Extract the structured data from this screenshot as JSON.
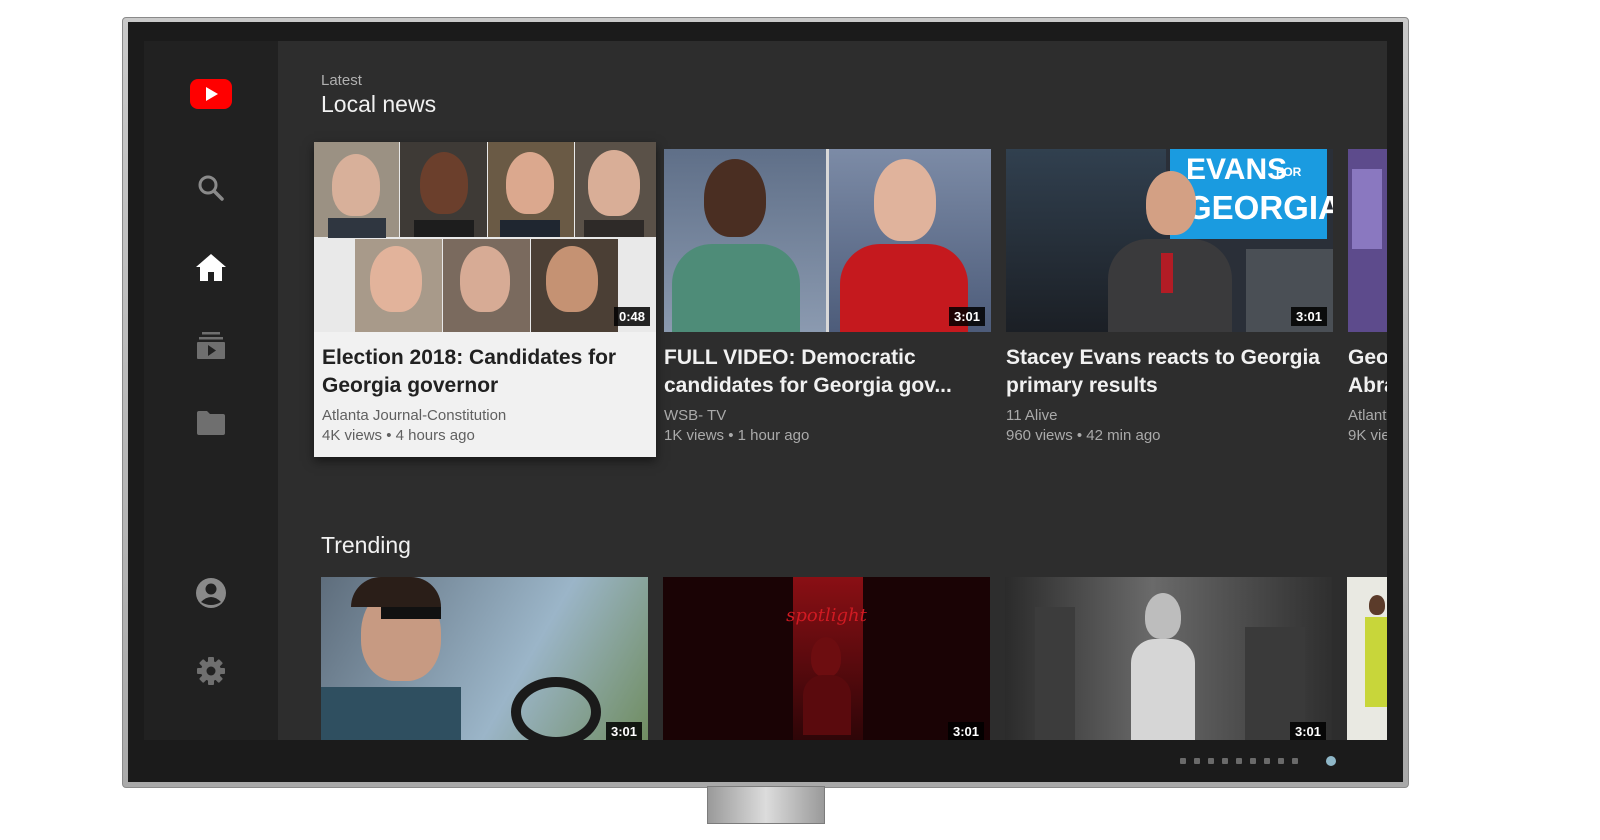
{
  "sidebar": {
    "logo": "youtube-logo",
    "items": [
      {
        "name": "search",
        "icon": "search-icon"
      },
      {
        "name": "home",
        "icon": "home-icon",
        "active": true
      },
      {
        "name": "subscriptions",
        "icon": "subscriptions-icon"
      },
      {
        "name": "library",
        "icon": "folder-icon"
      },
      {
        "name": "account",
        "icon": "account-icon"
      },
      {
        "name": "settings",
        "icon": "gear-icon"
      }
    ]
  },
  "sections": [
    {
      "label": "Latest",
      "title": "Local news",
      "cards": [
        {
          "title_line1": "Election 2018: Candidates for",
          "title_line2": "Georgia governor",
          "channel": "Atlanta Journal-Constitution",
          "meta": "4K views • 4 hours ago",
          "duration": "0:48",
          "focused": true
        },
        {
          "title_line1": "FULL VIDEO: Democratic",
          "title_line2": "candidates for Georgia gov...",
          "channel": "WSB- TV",
          "meta": "1K views • 1 hour ago",
          "duration": "3:01"
        },
        {
          "title_line1": "Stacey Evans reacts to Georgia",
          "title_line2": "primary results",
          "channel": "11 Alive",
          "meta": "960 views • 42 min ago",
          "duration": "3:01",
          "thumb_text_1": "EVANS",
          "thumb_text_2": "GEORGIA",
          "thumb_text_for": "FOR"
        },
        {
          "title_line1": "Geo",
          "title_line2": "Abra",
          "channel": "Atlant",
          "meta": "9K vie"
        }
      ]
    },
    {
      "title": "Trending",
      "cards": [
        {
          "duration": "3:01"
        },
        {
          "duration": "3:01",
          "thumb_text": "spotlight"
        },
        {
          "duration": "3:01"
        },
        {}
      ]
    }
  ],
  "colors": {
    "screen_bg": "#2d2d2d",
    "sidebar_bg": "#212121",
    "brand_red": "#ff0000",
    "focused_card_bg": "#f1f1f1"
  }
}
